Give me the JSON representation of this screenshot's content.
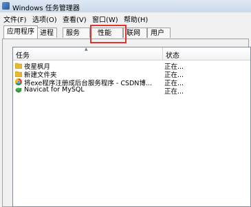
{
  "window": {
    "title": "Windows 任务管理器"
  },
  "menu": {
    "items": [
      "文件(F)",
      "选项(O)",
      "查看(V)",
      "窗口(W)",
      "帮助(H)"
    ]
  },
  "tabs": [
    {
      "label": "应用程序",
      "active": true
    },
    {
      "label": "进程",
      "active": false
    },
    {
      "label": "服务",
      "active": false
    },
    {
      "label": "性能",
      "active": false
    },
    {
      "label": "联网",
      "active": false
    },
    {
      "label": "用户",
      "active": false
    }
  ],
  "list": {
    "columns": [
      "任务",
      "状态"
    ],
    "rows": [
      {
        "name": "夜星枫月",
        "status": "正在...",
        "icon": "folder-icon"
      },
      {
        "name": "新建文件夹",
        "status": "正在...",
        "icon": "folder-icon"
      },
      {
        "name": "将exe程序注册成后台服务程序 - CSDN博...",
        "status": "正在...",
        "icon": "chrome-icon"
      },
      {
        "name": "Navicat for MySQL",
        "status": "正在...",
        "icon": "navicat-icon"
      }
    ]
  },
  "colors": {
    "highlight": "#e0332c",
    "titlebar": "#c9d8ea"
  }
}
